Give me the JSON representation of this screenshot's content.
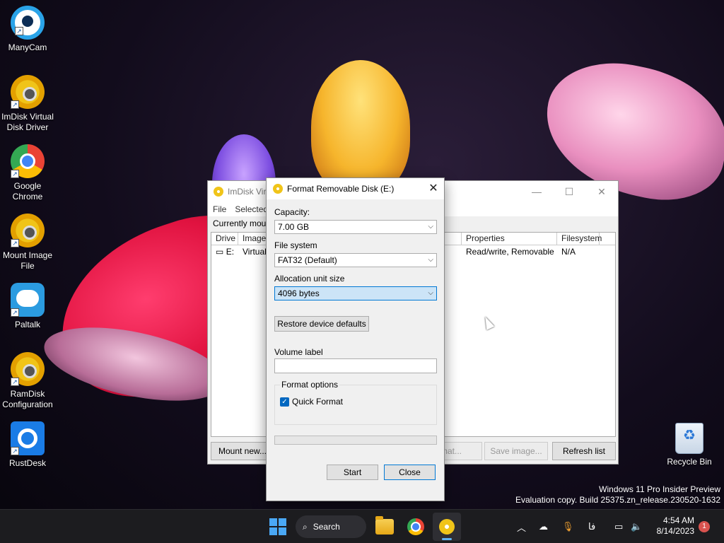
{
  "desktop": {
    "icons": [
      {
        "label": "ManyCam",
        "icon": "manycam-icon"
      },
      {
        "label": "ImDisk Virtual Disk Driver",
        "icon": "imdisk-icon"
      },
      {
        "label": "Google Chrome",
        "icon": "chrome-icon"
      },
      {
        "label": "Mount Image File",
        "icon": "mount-image-icon"
      },
      {
        "label": "Paltalk",
        "icon": "paltalk-icon"
      },
      {
        "label": "RamDisk Configuration",
        "icon": "ramdisk-icon"
      },
      {
        "label": "RustDesk",
        "icon": "rustdesk-icon"
      }
    ],
    "recycle_bin": "Recycle Bin",
    "watermark": {
      "line1": "Windows 11 Pro Insider Preview",
      "line2": "Evaluation copy. Build 25375.zn_release.230520-1632"
    }
  },
  "imdisk_window": {
    "title": "ImDisk Vir",
    "menu": [
      "File",
      "Selected"
    ],
    "list_label": "Currently mounte",
    "columns": {
      "drive": "Drive",
      "image": "Image",
      "properties": "Properties",
      "filesystem": "Filesystem"
    },
    "rows": [
      {
        "drive": "E:",
        "image": "Virtual",
        "properties": "Read/write, Removable",
        "filesystem": "N/A"
      }
    ],
    "buttons": {
      "mount_new": "Mount new...",
      "format": "mat...",
      "save_image": "Save image...",
      "refresh": "Refresh list"
    }
  },
  "format_dialog": {
    "title": "Format Removable Disk (E:)",
    "capacity_label": "Capacity:",
    "capacity_value": "7.00 GB",
    "filesystem_label": "File system",
    "filesystem_value": "FAT32 (Default)",
    "allocation_label": "Allocation unit size",
    "allocation_value": "4096 bytes",
    "restore_button": "Restore device defaults",
    "volume_label": "Volume label",
    "volume_value": "",
    "format_options_label": "Format options",
    "quick_format_label": "Quick Format",
    "quick_format_checked": true,
    "progress": 0,
    "start_button": "Start",
    "close_button": "Close"
  },
  "taskbar": {
    "search_label": "Search",
    "time": "4:54 AM",
    "date": "8/14/2023",
    "notification_count": "1",
    "lang_indicator": "فا"
  }
}
